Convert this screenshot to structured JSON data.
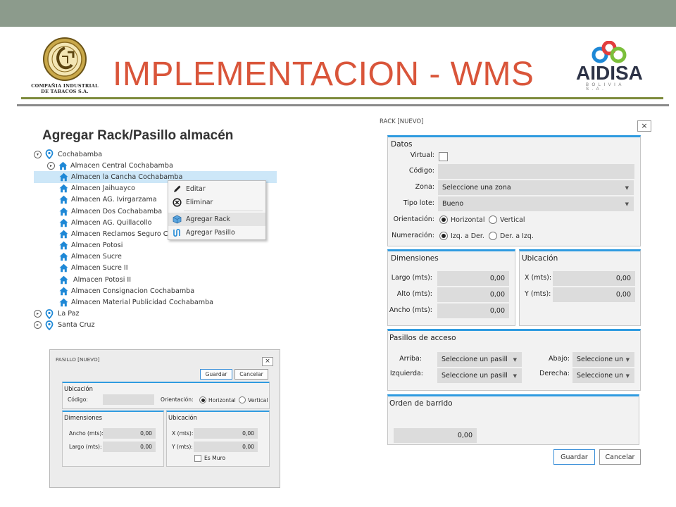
{
  "slide": {
    "title": "IMPLEMENTACION - WMS",
    "subtitle": "Agregar Rack/Pasillo almacén",
    "colors": {
      "topbar": "#8c9b8c",
      "title": "#d9553a",
      "accent": "#2f9be0",
      "rule": "#7d8a3c"
    }
  },
  "logos": {
    "left": {
      "line1": "COMPAÑIA INDUSTRIAL",
      "line2": "DE TABACOS S.A.",
      "emblem": "CIT"
    },
    "right": {
      "word": "AIDISA",
      "sub": "BOLIVIA S.A."
    }
  },
  "tree": {
    "root": "Cochabamba",
    "children": [
      "Almacen Central Cochabamba",
      "Almacen la Cancha Cochabamba",
      "Almacen Jaihuayco",
      "Almacen AG. Ivirgarzama",
      "Almacen Dos Cochabamba",
      "Almacen AG. Quillacollo",
      "Almacen Reclamos Seguro Coc",
      "Almacen Potosi",
      "Almacen Sucre",
      "Almacen Sucre II",
      "Almacen Potosi II",
      "Almacen Consignacion Cochabamba",
      "Almacen Material Publicidad Cochabamba"
    ],
    "others": [
      "La Paz",
      "Santa Cruz"
    ],
    "selected_index": 1
  },
  "context_menu": {
    "items": [
      {
        "label": "Editar",
        "icon": "pencil-icon"
      },
      {
        "label": "Eliminar",
        "icon": "delete-circle-icon"
      },
      {
        "label": "Agregar Rack",
        "icon": "rack-box-icon"
      },
      {
        "label": "Agregar Pasillo",
        "icon": "aisle-icon"
      }
    ],
    "highlighted": "Agregar Rack"
  },
  "rack_dialog": {
    "title": "RACK [NUEVO]",
    "close": "×",
    "datos": {
      "title": "Datos",
      "virtual_label": "Virtual:",
      "codigo_label": "Código:",
      "codigo_value": "",
      "zona_label": "Zona:",
      "zona_value": "Seleccione una zona",
      "tipo_label": "Tipo lote:",
      "tipo_value": "Bueno",
      "orientacion_label": "Orientación:",
      "orientacion_options": [
        "Horizontal",
        "Vertical"
      ],
      "orientacion_selected": "Horizontal",
      "numeracion_label": "Numeración:",
      "numeracion_options": [
        "Izq. a Der.",
        "Der. a Izq."
      ],
      "numeracion_selected": "Izq. a Der."
    },
    "dimensiones": {
      "title": "Dimensiones",
      "largo_label": "Largo (mts):",
      "largo": "0,00",
      "alto_label": "Alto (mts):",
      "alto": "0,00",
      "ancho_label": "Ancho (mts):",
      "ancho": "0,00"
    },
    "ubicacion": {
      "title": "Ubicación",
      "x_label": "X (mts):",
      "x": "0,00",
      "y_label": "Y (mts):",
      "y": "0,00"
    },
    "pasillos": {
      "title": "Pasillos de acceso",
      "arriba_label": "Arriba:",
      "arriba": "Seleccione un pasill",
      "izquierda_label": "Izquierda:",
      "izquierda": "Seleccione un pasill",
      "abajo_label": "Abajo:",
      "abajo": "Seleccione un",
      "derecha_label": "Derecha:",
      "derecha": "Seleccione un"
    },
    "orden": {
      "title": "Orden de barrido",
      "value": "0,00"
    },
    "guardar": "Guardar",
    "cancelar": "Cancelar"
  },
  "pasillo_dialog": {
    "title": "PASILLO [NUEVO]",
    "close": "×",
    "guardar": "Guardar",
    "cancelar": "Cancelar",
    "ubicacion": {
      "title": "Ubicación",
      "codigo_label": "Código:",
      "codigo_value": "",
      "orientacion_label": "Orientación:",
      "orientacion_options": [
        "Horizontal",
        "Vertical"
      ],
      "orientacion_selected": "Horizontal"
    },
    "dimensiones": {
      "title": "Dimensiones",
      "ancho_label": "Ancho (mts):",
      "ancho": "0,00",
      "largo_label": "Largo (mts):",
      "largo": "0,00"
    },
    "ubicacion2": {
      "title": "Ubicación",
      "x_label": "X (mts):",
      "x": "0,00",
      "y_label": "Y (mts):",
      "y": "0,00",
      "es_muro_label": "Es Muro"
    }
  }
}
